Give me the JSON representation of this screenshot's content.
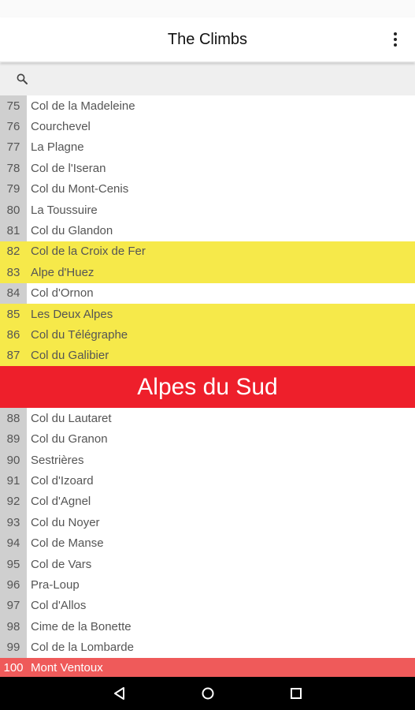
{
  "app": {
    "title": "The Climbs"
  },
  "icons": {
    "menu": "more-vert-icon",
    "search": "search-icon",
    "back": "back-triangle-icon",
    "home": "home-circle-icon",
    "recents": "recents-square-icon"
  },
  "search": {
    "value": "",
    "placeholder": ""
  },
  "colors": {
    "highlight": "#f6e94a",
    "section": "#ee1f2b",
    "selected_row": "#ef5a5a",
    "number_column": "#cfcfcf"
  },
  "list": {
    "group_before": [
      {
        "num": "75",
        "name": "Col de la Madeleine",
        "style": "normal"
      },
      {
        "num": "76",
        "name": "Courchevel",
        "style": "normal"
      },
      {
        "num": "77",
        "name": "La Plagne",
        "style": "normal"
      },
      {
        "num": "78",
        "name": "Col de l'Iseran",
        "style": "normal"
      },
      {
        "num": "79",
        "name": "Col du Mont-Cenis",
        "style": "normal"
      },
      {
        "num": "80",
        "name": "La Toussuire",
        "style": "normal"
      },
      {
        "num": "81",
        "name": "Col du Glandon",
        "style": "normal"
      },
      {
        "num": "82",
        "name": "Col de la Croix de Fer",
        "style": "highlight"
      },
      {
        "num": "83",
        "name": "Alpe d'Huez",
        "style": "highlight"
      },
      {
        "num": "84",
        "name": "Col d'Ornon",
        "style": "normal"
      },
      {
        "num": "85",
        "name": "Les Deux Alpes",
        "style": "highlight"
      },
      {
        "num": "86",
        "name": "Col du Télégraphe",
        "style": "highlight"
      },
      {
        "num": "87",
        "name": "Col du Galibier",
        "style": "highlight"
      }
    ],
    "section_title": "Alpes du Sud",
    "group_after": [
      {
        "num": "88",
        "name": "Col du Lautaret",
        "style": "normal"
      },
      {
        "num": "89",
        "name": "Col du Granon",
        "style": "normal"
      },
      {
        "num": "90",
        "name": "Sestrières",
        "style": "normal"
      },
      {
        "num": "91",
        "name": "Col d'Izoard",
        "style": "normal"
      },
      {
        "num": "92",
        "name": "Col d'Agnel",
        "style": "normal"
      },
      {
        "num": "93",
        "name": "Col du Noyer",
        "style": "normal"
      },
      {
        "num": "94",
        "name": "Col de Manse",
        "style": "normal"
      },
      {
        "num": "95",
        "name": "Col de Vars",
        "style": "normal"
      },
      {
        "num": "96",
        "name": "Pra-Loup",
        "style": "normal"
      },
      {
        "num": "97",
        "name": "Col d'Allos",
        "style": "normal"
      },
      {
        "num": "98",
        "name": "Cime de la Bonette",
        "style": "normal"
      },
      {
        "num": "99",
        "name": "Col de la Lombarde",
        "style": "normal"
      },
      {
        "num": "100",
        "name": "Mont Ventoux",
        "style": "last"
      }
    ]
  }
}
